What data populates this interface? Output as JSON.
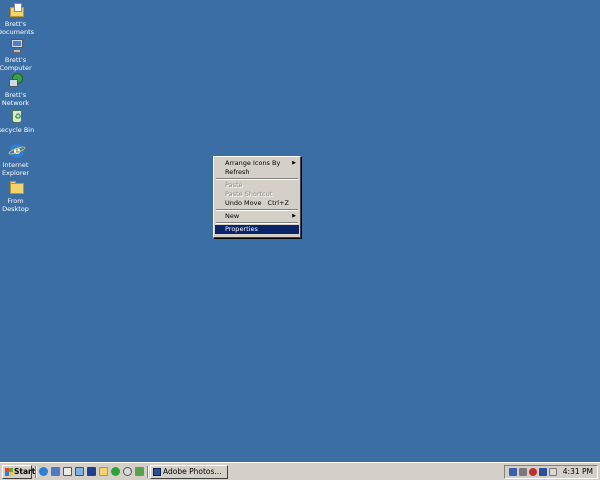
{
  "desktop": {
    "icons": [
      {
        "label": "Brett's\nDocuments",
        "icon": "my-documents-icon"
      },
      {
        "label": "Brett's\nComputer",
        "icon": "my-computer-icon"
      },
      {
        "label": "Brett's\nNetwork",
        "icon": "network-places-icon"
      },
      {
        "label": "Recycle Bin",
        "icon": "recycle-bin-icon"
      },
      {
        "label": "Internet\nExplorer",
        "icon": "internet-explorer-icon"
      },
      {
        "label": "From\nDesktop",
        "icon": "folder-icon"
      }
    ],
    "background_color": "#3a6ea5"
  },
  "context_menu": {
    "items": [
      {
        "label": "Arrange Icons By",
        "submenu": true,
        "enabled": true
      },
      {
        "label": "Refresh",
        "enabled": true
      },
      {
        "label": "Paste",
        "enabled": false
      },
      {
        "label": "Paste Shortcut",
        "enabled": false
      },
      {
        "label": "Undo Move",
        "shortcut": "Ctrl+Z",
        "enabled": true
      },
      {
        "label": "New",
        "submenu": true,
        "enabled": true
      },
      {
        "label": "Properties",
        "enabled": true,
        "selected": true
      }
    ],
    "highlight_color": "#0a246a"
  },
  "taskbar": {
    "start_label": "Start",
    "task_label": "Adobe Photos...",
    "clock": "4:31 PM",
    "quick_launch": [
      "ie-icon",
      "outlook-icon",
      "mail-icon",
      "explorer-icon",
      "app-icon",
      "folder-icon",
      "green-icon",
      "help-icon",
      "media-icon"
    ]
  }
}
